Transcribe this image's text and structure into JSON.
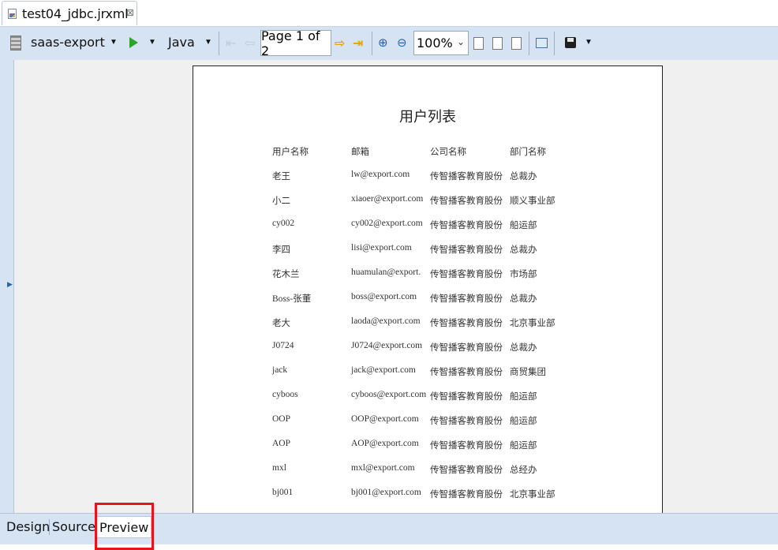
{
  "editor_tab": {
    "title": "test04_jdbc.jrxml",
    "close_glyph": "⊠"
  },
  "toolbar": {
    "datasource_label": "saas-export",
    "language_label": "Java",
    "page_indicator": "Page 1 of 2",
    "zoom_value": "100%"
  },
  "report": {
    "title": "用户列表",
    "headers": [
      "用户名称",
      "邮箱",
      "公司名称",
      "部门名称"
    ],
    "rows": [
      [
        "老王",
        "lw@export.com",
        "传智播客教育股份",
        "总裁办"
      ],
      [
        "小二",
        "xiaoer@export.com",
        "传智播客教育股份",
        "顺义事业部"
      ],
      [
        "cy002",
        "cy002@export.com",
        "传智播客教育股份",
        "船运部"
      ],
      [
        "李四",
        "lisi@export.com",
        "传智播客教育股份",
        "总裁办"
      ],
      [
        "花木兰",
        "huamulan@export.",
        "传智播客教育股份",
        "市场部"
      ],
      [
        "Boss-张董",
        "boss@export.com",
        "传智播客教育股份",
        "总裁办"
      ],
      [
        "老大",
        "laoda@export.com",
        "传智播客教育股份",
        "北京事业部"
      ],
      [
        "J0724",
        "J0724@export.com",
        "传智播客教育股份",
        "总裁办"
      ],
      [
        "jack",
        "jack@export.com",
        "传智播客教育股份",
        "商贸集团"
      ],
      [
        "cyboos",
        "cyboos@export.com",
        "传智播客教育股份",
        "船运部"
      ],
      [
        "OOP",
        "OOP@export.com",
        "传智播客教育股份",
        "船运部"
      ],
      [
        "AOP",
        "AOP@export.com",
        "传智播客教育股份",
        "船运部"
      ],
      [
        "mxl",
        "mxl@export.com",
        "传智播客教育股份",
        "总经办"
      ],
      [
        "bj001",
        "bj001@export.com",
        "传智播客教育股份",
        "北京事业部"
      ]
    ]
  },
  "bottom_tabs": [
    {
      "label": "Design"
    },
    {
      "label": "Source"
    },
    {
      "label": "Preview",
      "selected": true
    }
  ],
  "colors": {
    "toolbar_bg": "#d6e3f2",
    "highlight": "#e8141c",
    "run_green": "#2ea32e"
  }
}
